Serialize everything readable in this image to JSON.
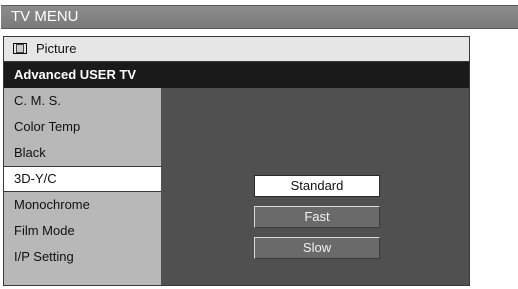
{
  "title": "TV MENU",
  "menu": {
    "section_label": "Picture",
    "section_icon": "picture-icon",
    "submenu_title": "Advanced USER TV",
    "items": [
      {
        "label": "C. M. S.",
        "selected": false
      },
      {
        "label": "Color Temp",
        "selected": false
      },
      {
        "label": "Black",
        "selected": false
      },
      {
        "label": "3D-Y/C",
        "selected": true
      },
      {
        "label": "Monochrome",
        "selected": false
      },
      {
        "label": "Film Mode",
        "selected": false
      },
      {
        "label": "I/P Setting",
        "selected": false
      }
    ],
    "options": [
      {
        "label": "Standard",
        "selected": true
      },
      {
        "label": "Fast",
        "selected": false
      },
      {
        "label": "Slow",
        "selected": false
      }
    ]
  },
  "colors": {
    "title_bar": "#808080",
    "submenu_header": "#1a1a1a",
    "list_background": "#b8b8b8",
    "panel_background": "#505050",
    "selected_background": "#ffffff"
  }
}
